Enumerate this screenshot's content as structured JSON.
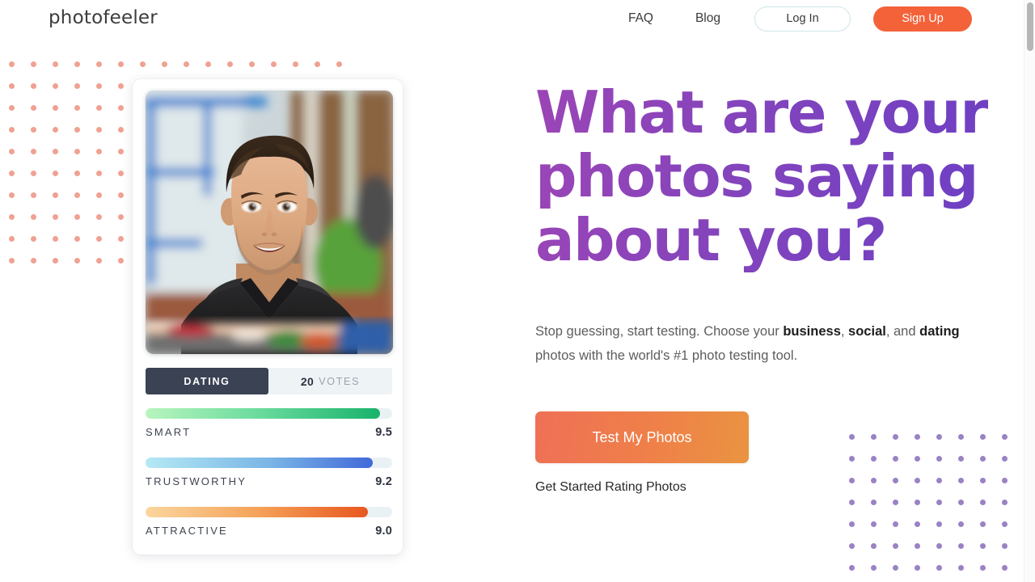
{
  "header": {
    "brand": "photofeeler",
    "nav": [
      {
        "name": "faq",
        "label": "FAQ"
      },
      {
        "name": "blog",
        "label": "Blog"
      }
    ],
    "login_label": "Log In",
    "signup_label": "Sign Up",
    "signup_color": "#f4623a",
    "login_border_color": "#cfe5e8"
  },
  "hero": {
    "headline": "What are your photos saying about you?",
    "headline_color_start": "#9b45b6",
    "headline_color_end": "#6d3fc4",
    "subtext_parts": [
      {
        "text": "Stop guessing, start testing. Choose your ",
        "bold": false
      },
      {
        "text": "business",
        "bold": true
      },
      {
        "text": ", ",
        "bold": false
      },
      {
        "text": "social",
        "bold": true
      },
      {
        "text": ", and ",
        "bold": false
      },
      {
        "text": "dating",
        "bold": true
      },
      {
        "text": " photos with the world's #1 photo testing tool.",
        "bold": false
      }
    ],
    "cta_label": "Test My Photos",
    "cta_color_start": "#ef7056",
    "cta_color_end": "#e99441",
    "secondary_link": "Get Started Rating Photos"
  },
  "photo_card": {
    "photo_alt": "smiling-man-portrait",
    "segment": {
      "category_label": "DATING",
      "votes_count": "20",
      "votes_label": "VOTES",
      "active_bg": "#3b4254",
      "inactive_bg": "#eef3f6"
    },
    "ratings": [
      {
        "name": "smart",
        "label": "SMART",
        "score": "9.5",
        "percent": 95,
        "color_start": "#b8f5bd",
        "color_end": "#19b36b"
      },
      {
        "name": "trustworthy",
        "label": "TRUSTWORTHY",
        "score": "9.2",
        "percent": 92,
        "color_start": "#b5e9f4",
        "color_end": "#4169d8"
      },
      {
        "name": "attractive",
        "label": "ATTRACTIVE",
        "score": "9.0",
        "percent": 90,
        "color_start": "#fbd69e",
        "color_end": "#e8571f"
      }
    ],
    "track_color": "#eaf1f4"
  },
  "decor": {
    "left_dots_color": "#f0a192",
    "right_dots_color": "#9a82c4",
    "left_dots_cols": 8,
    "left_dots_rows": 10,
    "left_top_strip_cols": 16,
    "right_dots_cols": 8,
    "right_dots_rows": 7
  }
}
